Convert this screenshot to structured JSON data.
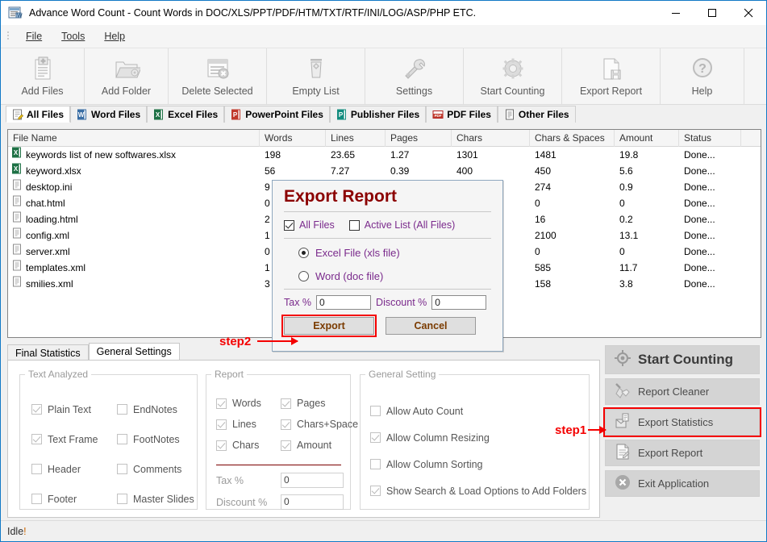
{
  "window": {
    "title": "Advance Word Count - Count Words in DOC/XLS/PPT/PDF/HTM/TXT/RTF/INI/LOG/ASP/PHP ETC.",
    "minimize": "—",
    "maximize": "□",
    "close": "✕"
  },
  "menubar": {
    "items": [
      {
        "label": "File"
      },
      {
        "label": "Tools"
      },
      {
        "label": "Help"
      }
    ]
  },
  "toolbar": {
    "items": [
      {
        "label": "Add Files",
        "icon": "add-files-icon"
      },
      {
        "label": "Add Folder",
        "icon": "add-folder-icon"
      },
      {
        "label": "Delete Selected",
        "icon": "delete-selected-icon"
      },
      {
        "label": "Empty List",
        "icon": "empty-list-icon"
      },
      {
        "label": "Settings",
        "icon": "settings-icon"
      },
      {
        "label": "Start Counting",
        "icon": "start-counting-icon"
      },
      {
        "label": "Export Report",
        "icon": "export-report-icon"
      },
      {
        "label": "Help",
        "icon": "help-icon"
      }
    ]
  },
  "file_tabs": [
    {
      "label": "All Files",
      "active": true,
      "icon": "all-files-icon"
    },
    {
      "label": "Word Files",
      "active": false,
      "icon": "word-icon"
    },
    {
      "label": "Excel Files",
      "active": false,
      "icon": "excel-icon"
    },
    {
      "label": "PowerPoint Files",
      "active": false,
      "icon": "powerpoint-icon"
    },
    {
      "label": "Publisher Files",
      "active": false,
      "icon": "publisher-icon"
    },
    {
      "label": "PDF Files",
      "active": false,
      "icon": "pdf-icon"
    },
    {
      "label": "Other Files",
      "active": false,
      "icon": "other-files-icon"
    }
  ],
  "file_list": {
    "columns": [
      "File Name",
      "Words",
      "Lines",
      "Pages",
      "Chars",
      "Chars & Spaces",
      "Amount",
      "Status"
    ],
    "rows": [
      {
        "name": "keywords list of new softwares.xlsx",
        "icon": "excel-file-icon",
        "words": "198",
        "lines": "23.65",
        "pages": "1.27",
        "chars": "1301",
        "chars_spaces": "1481",
        "amount": "19.8",
        "status": "Done..."
      },
      {
        "name": "keyword.xlsx",
        "icon": "excel-file-icon",
        "words": "56",
        "lines": "7.27",
        "pages": "0.39",
        "chars": "400",
        "chars_spaces": "450",
        "amount": "5.6",
        "status": "Done..."
      },
      {
        "name": "desktop.ini",
        "icon": "text-file-icon",
        "words": "9",
        "lines": "",
        "pages": "",
        "chars": "",
        "chars_spaces": "274",
        "amount": "0.9",
        "status": "Done..."
      },
      {
        "name": "chat.html",
        "icon": "text-file-icon",
        "words": "0",
        "lines": "",
        "pages": "",
        "chars": "",
        "chars_spaces": "0",
        "amount": "0",
        "status": "Done..."
      },
      {
        "name": "loading.html",
        "icon": "text-file-icon",
        "words": "2",
        "lines": "",
        "pages": "",
        "chars": "",
        "chars_spaces": "16",
        "amount": "0.2",
        "status": "Done..."
      },
      {
        "name": "config.xml",
        "icon": "text-file-icon",
        "words": "1",
        "lines": "",
        "pages": "",
        "chars": "",
        "chars_spaces": "2100",
        "amount": "13.1",
        "status": "Done..."
      },
      {
        "name": "server.xml",
        "icon": "text-file-icon",
        "words": "0",
        "lines": "",
        "pages": "",
        "chars": "",
        "chars_spaces": "0",
        "amount": "0",
        "status": "Done..."
      },
      {
        "name": "templates.xml",
        "icon": "text-file-icon",
        "words": "1",
        "lines": "",
        "pages": "",
        "chars": "",
        "chars_spaces": "585",
        "amount": "11.7",
        "status": "Done..."
      },
      {
        "name": "smilies.xml",
        "icon": "text-file-icon",
        "words": "3",
        "lines": "",
        "pages": "",
        "chars": "",
        "chars_spaces": "158",
        "amount": "3.8",
        "status": "Done..."
      }
    ]
  },
  "bottom_tabs": [
    {
      "label": "Final Statistics",
      "active": false
    },
    {
      "label": "General Settings",
      "active": true
    }
  ],
  "text_analyzed": {
    "legend": "Text Analyzed",
    "left": [
      {
        "label": "Plain Text",
        "checked": true
      },
      {
        "label": "Text Frame",
        "checked": true
      },
      {
        "label": "Header",
        "checked": false
      },
      {
        "label": "Footer",
        "checked": false
      }
    ],
    "right": [
      {
        "label": "EndNotes",
        "checked": false
      },
      {
        "label": "FootNotes",
        "checked": false
      },
      {
        "label": "Comments",
        "checked": false
      },
      {
        "label": "Master Slides",
        "checked": false
      }
    ]
  },
  "report": {
    "legend": "Report",
    "left": [
      {
        "label": "Words",
        "checked": true
      },
      {
        "label": "Lines",
        "checked": true
      },
      {
        "label": "Chars",
        "checked": true
      }
    ],
    "right": [
      {
        "label": "Pages",
        "checked": true
      },
      {
        "label": "Chars+Space",
        "checked": true
      },
      {
        "label": "Amount",
        "checked": true
      }
    ],
    "tax_label": "Tax %",
    "tax_value": "0",
    "discount_label": "Discount %",
    "discount_value": "0"
  },
  "general_setting": {
    "legend": "General Setting",
    "items": [
      {
        "label": "Allow Auto Count",
        "checked": false
      },
      {
        "label": "Allow Column Resizing",
        "checked": true
      },
      {
        "label": "Allow Column Sorting",
        "checked": false
      },
      {
        "label": "Show Search & Load Options to Add Folders",
        "checked": true
      }
    ]
  },
  "actions": [
    {
      "label": "Start Counting",
      "icon": "gear-icon",
      "highlight": false,
      "big": true
    },
    {
      "label": "Report Cleaner",
      "icon": "broom-icon",
      "highlight": false,
      "big": false
    },
    {
      "label": "Export Statistics",
      "icon": "export-statistics-icon",
      "highlight": true,
      "big": false
    },
    {
      "label": "Export Report",
      "icon": "export-report-doc-icon",
      "highlight": false,
      "big": false
    },
    {
      "label": "Exit Application",
      "icon": "exit-icon",
      "highlight": false,
      "big": false
    }
  ],
  "modal": {
    "title": "Export Report",
    "all_files_label": "All Files",
    "all_files_checked": true,
    "active_list_label": "Active List (All Files)",
    "active_list_checked": false,
    "excel_label": "Excel File (xls file)",
    "word_label": "Word (doc file)",
    "selected_format": "excel",
    "tax_label": "Tax %",
    "tax_value": "0",
    "discount_label": "Discount %",
    "discount_value": "0",
    "export_label": "Export",
    "cancel_label": "Cancel"
  },
  "annotations": {
    "step1": "step1",
    "step2": "step2",
    "accent": "#f40000"
  },
  "statusbar": {
    "text": "Idle",
    "suffix": "!"
  }
}
